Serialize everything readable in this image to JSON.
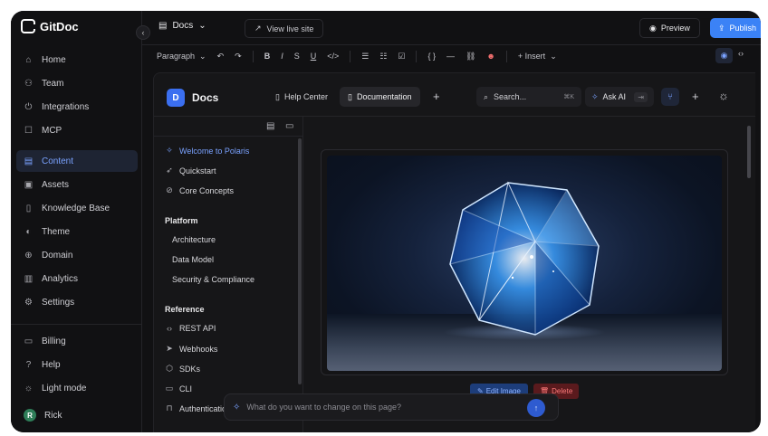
{
  "app": {
    "name": "GitDoc"
  },
  "sidebar": {
    "collapse_icon": "chevron-left-icon",
    "items": [
      {
        "label": "Home",
        "icon": "home-icon"
      },
      {
        "label": "Team",
        "icon": "users-icon"
      },
      {
        "label": "Integrations",
        "icon": "plug-icon"
      },
      {
        "label": "MCP",
        "icon": "robot-icon"
      },
      {
        "label": "Content",
        "icon": "document-icon",
        "active": true
      },
      {
        "label": "Assets",
        "icon": "image-icon"
      },
      {
        "label": "Knowledge Base",
        "icon": "book-icon"
      },
      {
        "label": "Theme",
        "icon": "palette-icon"
      },
      {
        "label": "Domain",
        "icon": "globe-icon"
      },
      {
        "label": "Analytics",
        "icon": "bar-chart-icon"
      },
      {
        "label": "Settings",
        "icon": "gear-icon"
      }
    ],
    "bottom": [
      {
        "label": "Billing",
        "icon": "credit-card-icon"
      },
      {
        "label": "Help",
        "icon": "help-icon"
      },
      {
        "label": "Light mode",
        "icon": "sun-icon"
      }
    ],
    "user": {
      "name": "Rick",
      "initial": "R"
    }
  },
  "topbar": {
    "crumb": "Docs",
    "view_live": "View live site",
    "preview": "Preview",
    "publish": "Publish"
  },
  "toolbar": {
    "paragraph": "Paragraph",
    "bold": "B",
    "italic": "I",
    "strike": "S",
    "underline": "U",
    "code": "</>",
    "codeblock": "{ }",
    "insert": "+ Insert"
  },
  "site": {
    "logo_letter": "D",
    "title": "Docs",
    "tabs": [
      {
        "label": "Help Center",
        "icon": "book-icon"
      },
      {
        "label": "Documentation",
        "icon": "book-icon",
        "active": true
      }
    ],
    "search_placeholder": "Search...",
    "search_shortcut": "⌘K",
    "ask_ai": "Ask AI",
    "ask_ai_shortcut": "⇥"
  },
  "tree": {
    "top_items": [
      {
        "label": "Welcome to Polaris",
        "icon": "sparkle-icon",
        "active": true
      },
      {
        "label": "Quickstart",
        "icon": "rocket-icon"
      },
      {
        "label": "Core Concepts",
        "icon": "compass-icon"
      }
    ],
    "sections": [
      {
        "title": "Platform",
        "items": [
          "Architecture",
          "Data Model",
          "Security & Compliance"
        ]
      },
      {
        "title": "Reference",
        "items": [
          {
            "label": "REST API",
            "icon": "code-icon"
          },
          {
            "label": "Webhooks",
            "icon": "send-icon"
          },
          {
            "label": "SDKs",
            "icon": "box-icon"
          },
          {
            "label": "CLI",
            "icon": "monitor-icon"
          },
          {
            "label": "Authentication",
            "icon": "lock-icon"
          }
        ]
      }
    ]
  },
  "content": {
    "edit_image": "Edit Image",
    "delete": "Delete"
  },
  "prompt": {
    "placeholder": "What do you want to change on this page?"
  }
}
